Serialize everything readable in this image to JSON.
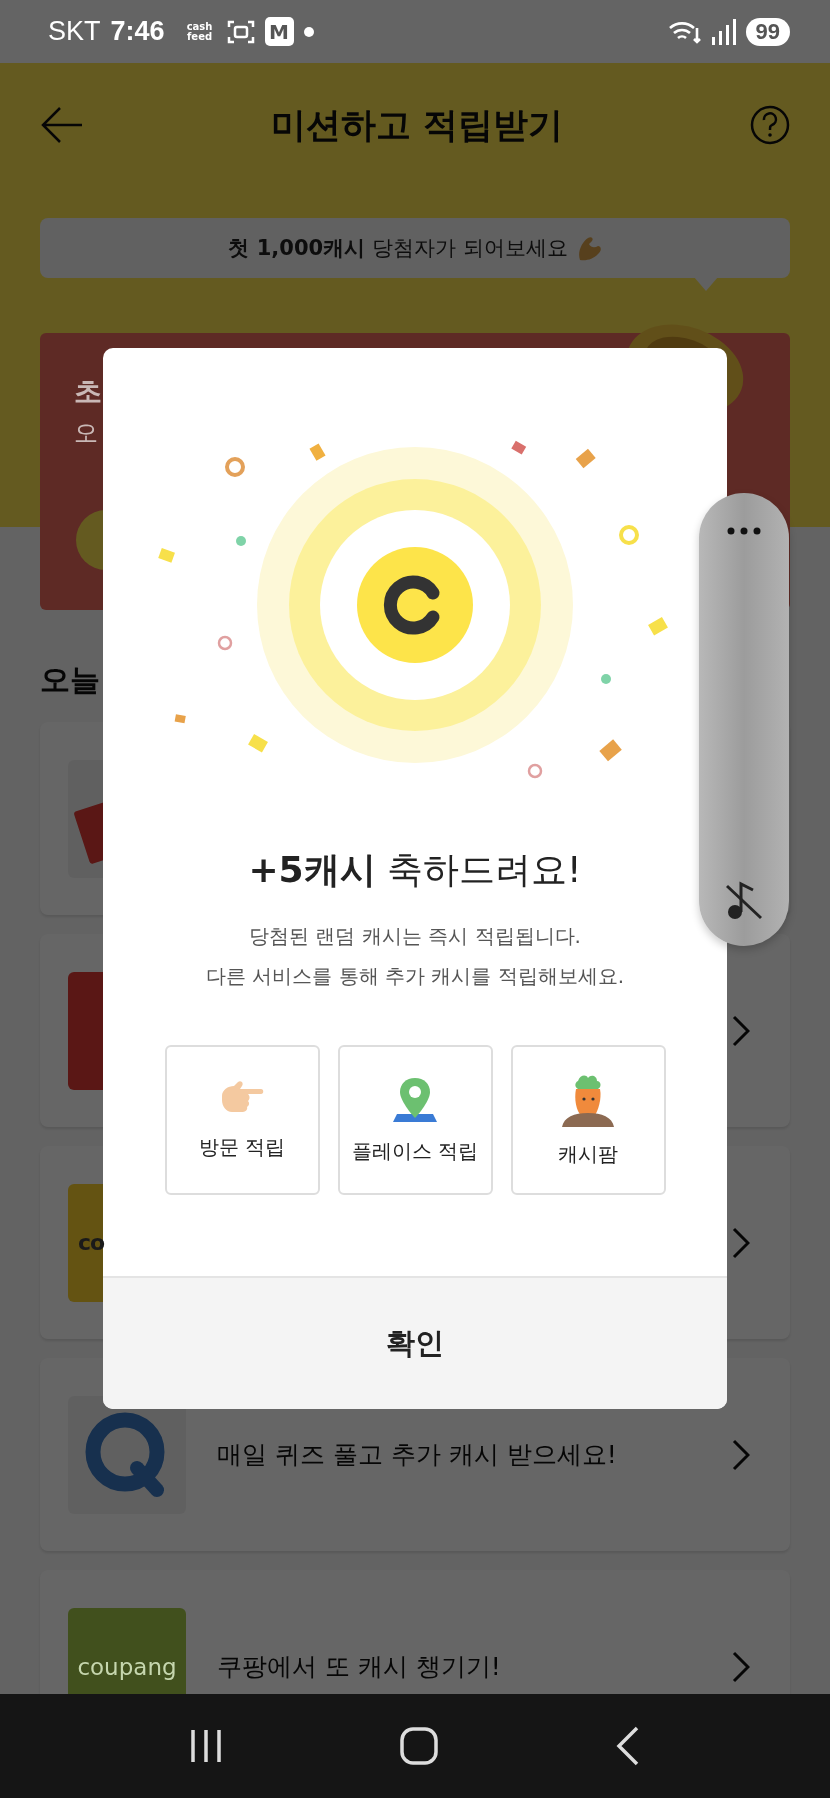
{
  "status_bar": {
    "carrier": "SKT",
    "time": "7:46",
    "notifications": [
      {
        "kind": "text_logo",
        "label": "cash feed"
      },
      {
        "kind": "gallery"
      },
      {
        "kind": "letter",
        "label": "M"
      },
      {
        "kind": "dot"
      }
    ],
    "battery": "99"
  },
  "header": {
    "title": "미션하고 적립받기"
  },
  "promo_bubble": {
    "text": "**첫 1,000캐시** 당첨자가 되어보세요"
  },
  "banner": {
    "title": "초",
    "subtitle": "오"
  },
  "section_title": "오늘",
  "missions": [
    {
      "kind": "red_tilted",
      "chevron_visible": false
    },
    {
      "kind": "red",
      "chevron_visible": true
    },
    {
      "kind": "yellow",
      "logo_text": "co",
      "chevron_visible": true
    },
    {
      "kind": "quiz",
      "text": "매일 퀴즈 풀고 추가 캐시 받으세요!",
      "chevron_visible": true
    },
    {
      "kind": "coupang",
      "logo_text": "coupang",
      "text": "쿠팡에서 또 캐시 챙기기!",
      "chevron_visible": true
    }
  ],
  "modal": {
    "title": "**+5캐시** 축하드려요!",
    "description": [
      "당첨된 랜덤 캐시는 즉시 적립됩니다.",
      "다른 서비스를 통해 추가 캐시를 적립해보세요."
    ],
    "services": [
      {
        "kind": "visit",
        "label": "방문 적립"
      },
      {
        "kind": "place",
        "label": "플레이스 적립"
      },
      {
        "kind": "farm",
        "label": "캐시팜"
      }
    ],
    "confirm": "확인"
  }
}
